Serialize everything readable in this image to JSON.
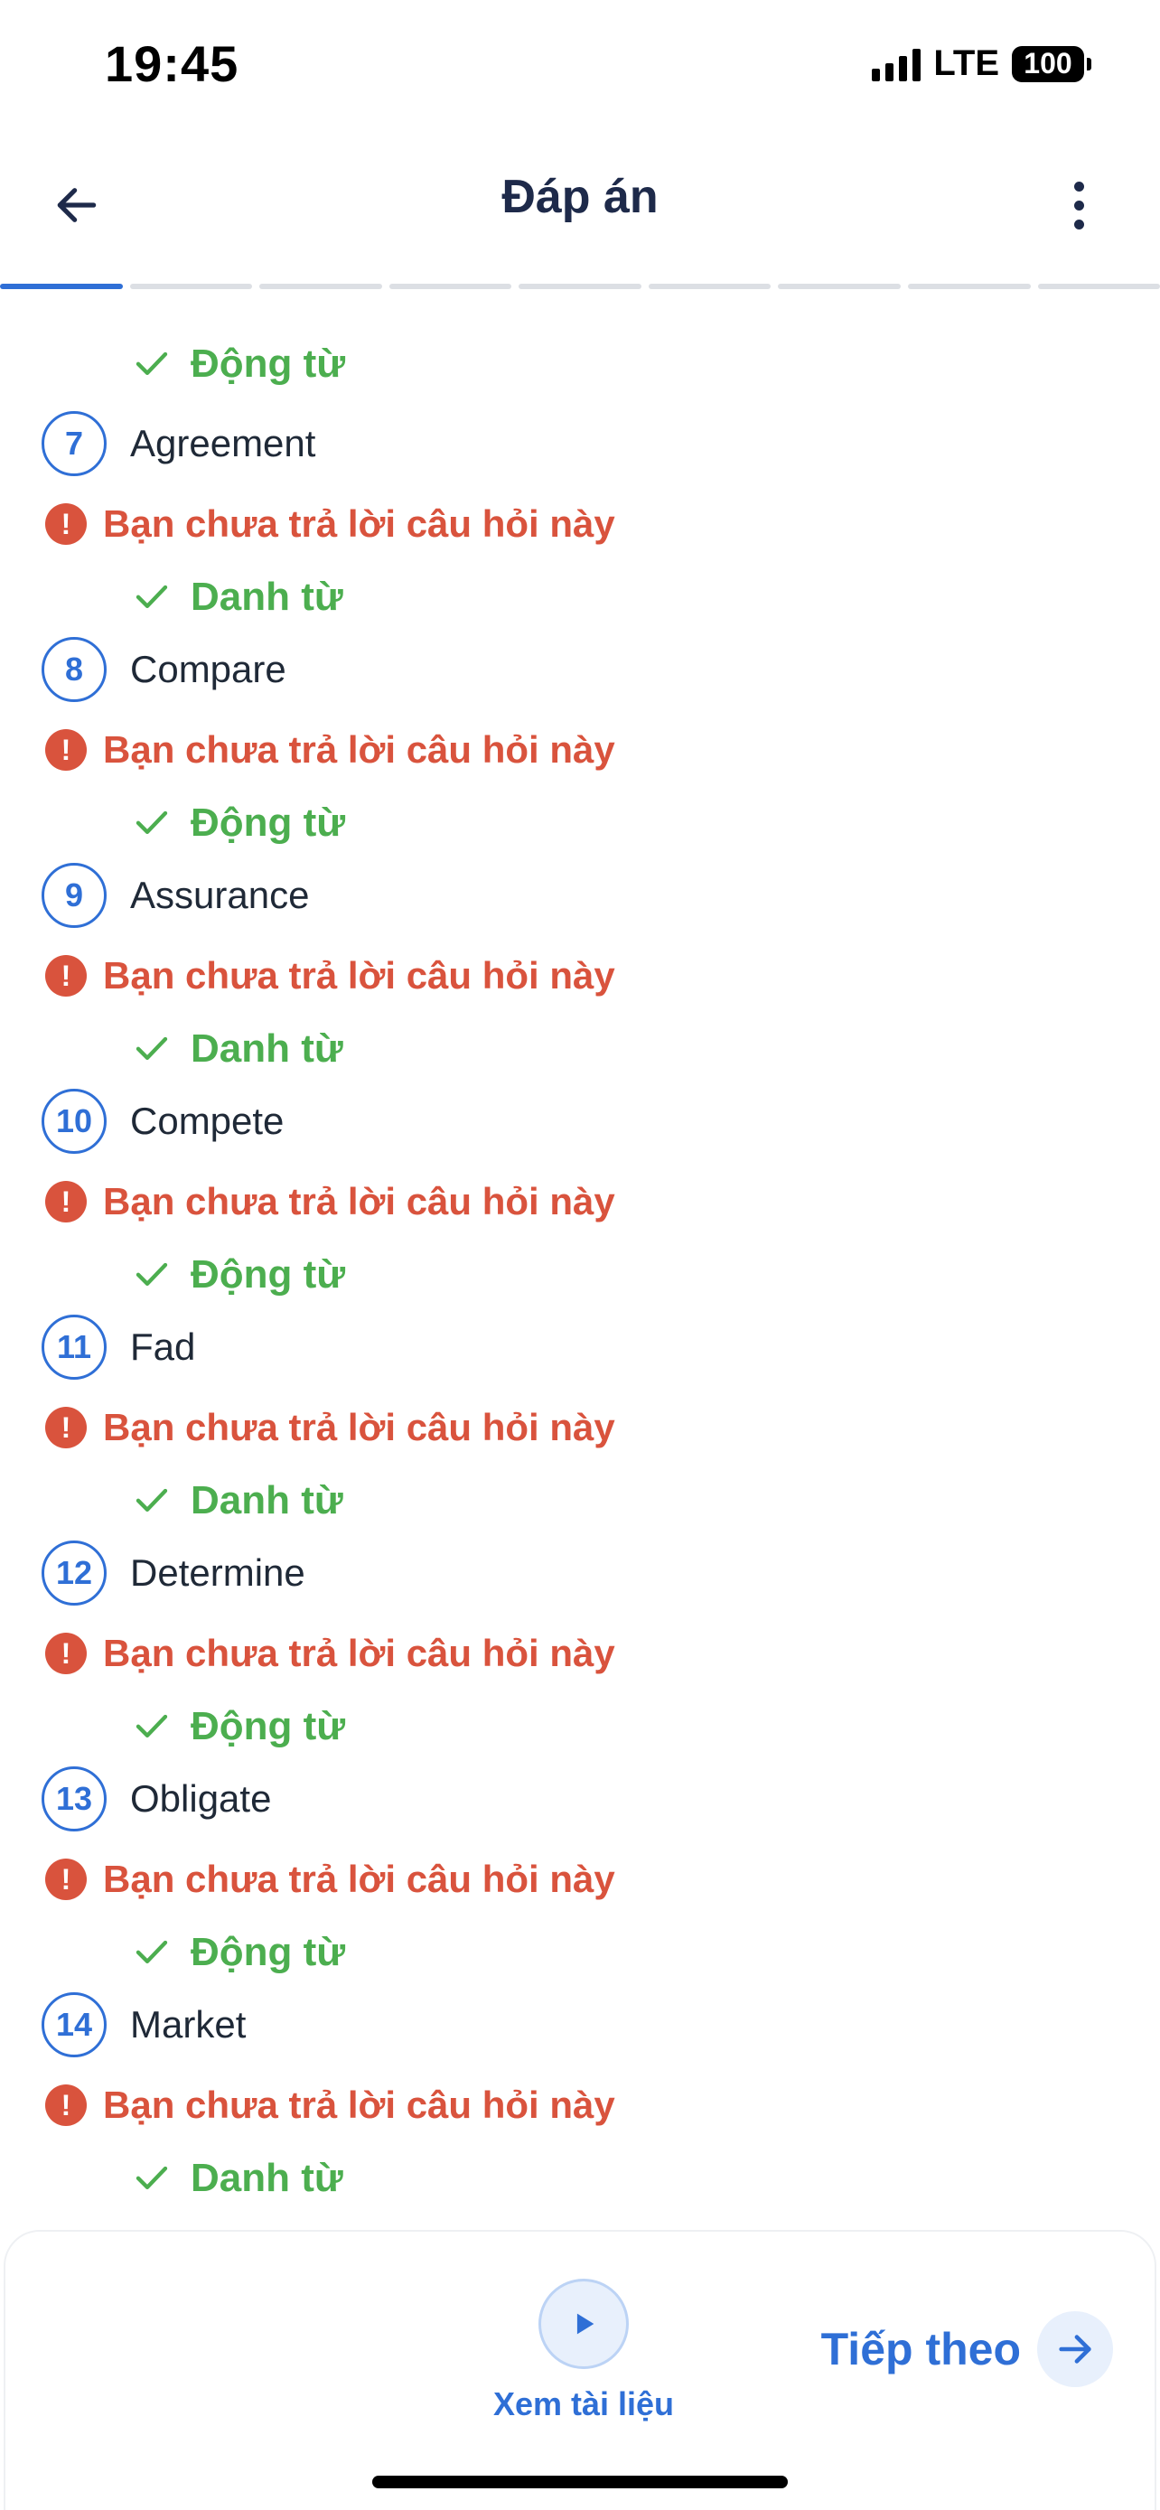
{
  "status_bar": {
    "time": "19:45",
    "network": "LTE",
    "battery": "100"
  },
  "nav": {
    "title": "Đáp án"
  },
  "progress": {
    "segments": 9,
    "active_index": 0
  },
  "top_answer": "Động từ",
  "questions": [
    {
      "number": "7",
      "word": "Agreement",
      "error": "Bạn chưa trả lời câu hỏi này",
      "answer": "Danh từ"
    },
    {
      "number": "8",
      "word": "Compare",
      "error": "Bạn chưa trả lời câu hỏi này",
      "answer": "Động từ"
    },
    {
      "number": "9",
      "word": "Assurance",
      "error": "Bạn chưa trả lời câu hỏi này",
      "answer": "Danh từ"
    },
    {
      "number": "10",
      "word": "Compete",
      "error": "Bạn chưa trả lời câu hỏi này",
      "answer": "Động từ"
    },
    {
      "number": "11",
      "word": "Fad",
      "error": "Bạn chưa trả lời câu hỏi này",
      "answer": "Danh từ"
    },
    {
      "number": "12",
      "word": "Determine",
      "error": "Bạn chưa trả lời câu hỏi này",
      "answer": "Động từ"
    },
    {
      "number": "13",
      "word": "Obligate",
      "error": "Bạn chưa trả lời câu hỏi này",
      "answer": "Động từ"
    },
    {
      "number": "14",
      "word": "Market",
      "error": "Bạn chưa trả lời câu hỏi này",
      "answer": "Danh từ"
    }
  ],
  "bottom": {
    "doc_label": "Xem tài liệu",
    "next_label": "Tiếp theo"
  },
  "colors": {
    "accent": "#2f6fd6",
    "correct": "#4cae4f",
    "error": "#d9533d",
    "title": "#1e2a4a"
  },
  "icons": {
    "back": "arrow-left-icon",
    "more": "more-vertical-icon",
    "check": "check-icon",
    "error": "exclamation-icon",
    "play": "play-icon",
    "next": "arrow-right-icon"
  }
}
